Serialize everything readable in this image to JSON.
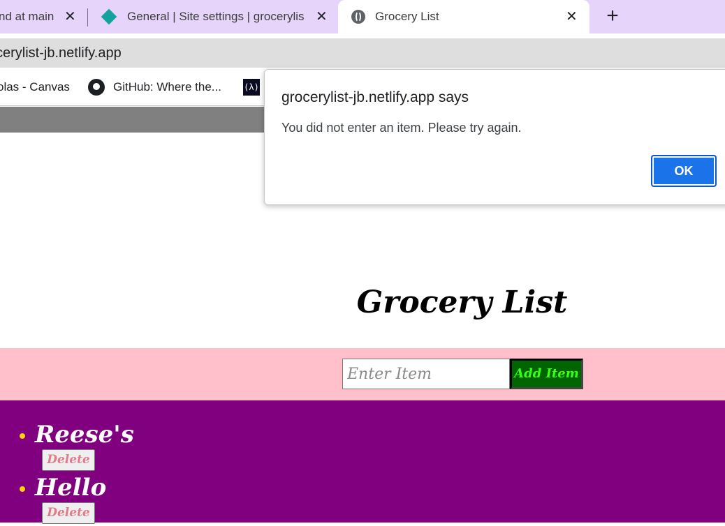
{
  "browser": {
    "tabs": [
      {
        "title": "nd at main",
        "close": "✕"
      },
      {
        "title": "General | Site settings | grocerylis",
        "close": "✕"
      },
      {
        "title": "Grocery List",
        "close": "✕"
      }
    ],
    "new_tab": "+",
    "address": "cerylist-jb.netlify.app",
    "bookmarks": [
      {
        "label": "olas - Canvas"
      },
      {
        "label": "GitHub: Where the..."
      },
      {
        "label": "(λ)"
      }
    ]
  },
  "page": {
    "title": "Grocery List",
    "input_placeholder": "Enter Item",
    "add_label": "Add Item",
    "items": [
      {
        "name": "Reese's",
        "delete_label": "Delete"
      },
      {
        "name": "Hello",
        "delete_label": "Delete"
      }
    ]
  },
  "dialog": {
    "title": "grocerylist-jb.netlify.app says",
    "message": "You did not enter an item. Please try again.",
    "ok_label": "OK"
  },
  "colors": {
    "form_band": "#ffc0cb",
    "list_band": "#800080",
    "add_button": "#006400",
    "ok_button": "#1a73e8"
  }
}
